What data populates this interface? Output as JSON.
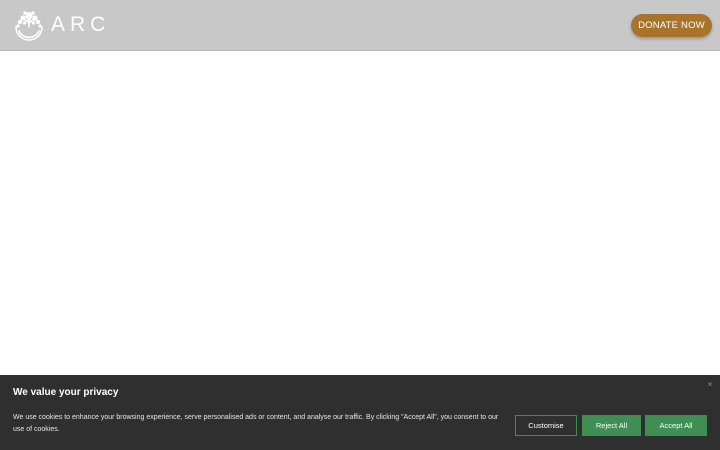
{
  "header": {
    "logo_text": "ARC",
    "donate_label": "DONATE NOW"
  },
  "cookie_banner": {
    "title": "We value your privacy",
    "text": "We use cookies to enhance your browsing experience, serve personalised ads or content, and analyse our traffic. By clicking \"Accept All\", you consent to our use of cookies.",
    "close_symbol": "×",
    "customise_label": "Customise",
    "reject_label": "Reject All",
    "accept_label": "Accept All"
  },
  "colors": {
    "header_bg": "#c8c8c8",
    "donate_bg": "#a8732a",
    "banner_bg": "#2f2f2f",
    "button_green": "#3f8e54"
  },
  "icons": {
    "logo": "arc-tree-logo-icon",
    "close": "close-icon"
  }
}
